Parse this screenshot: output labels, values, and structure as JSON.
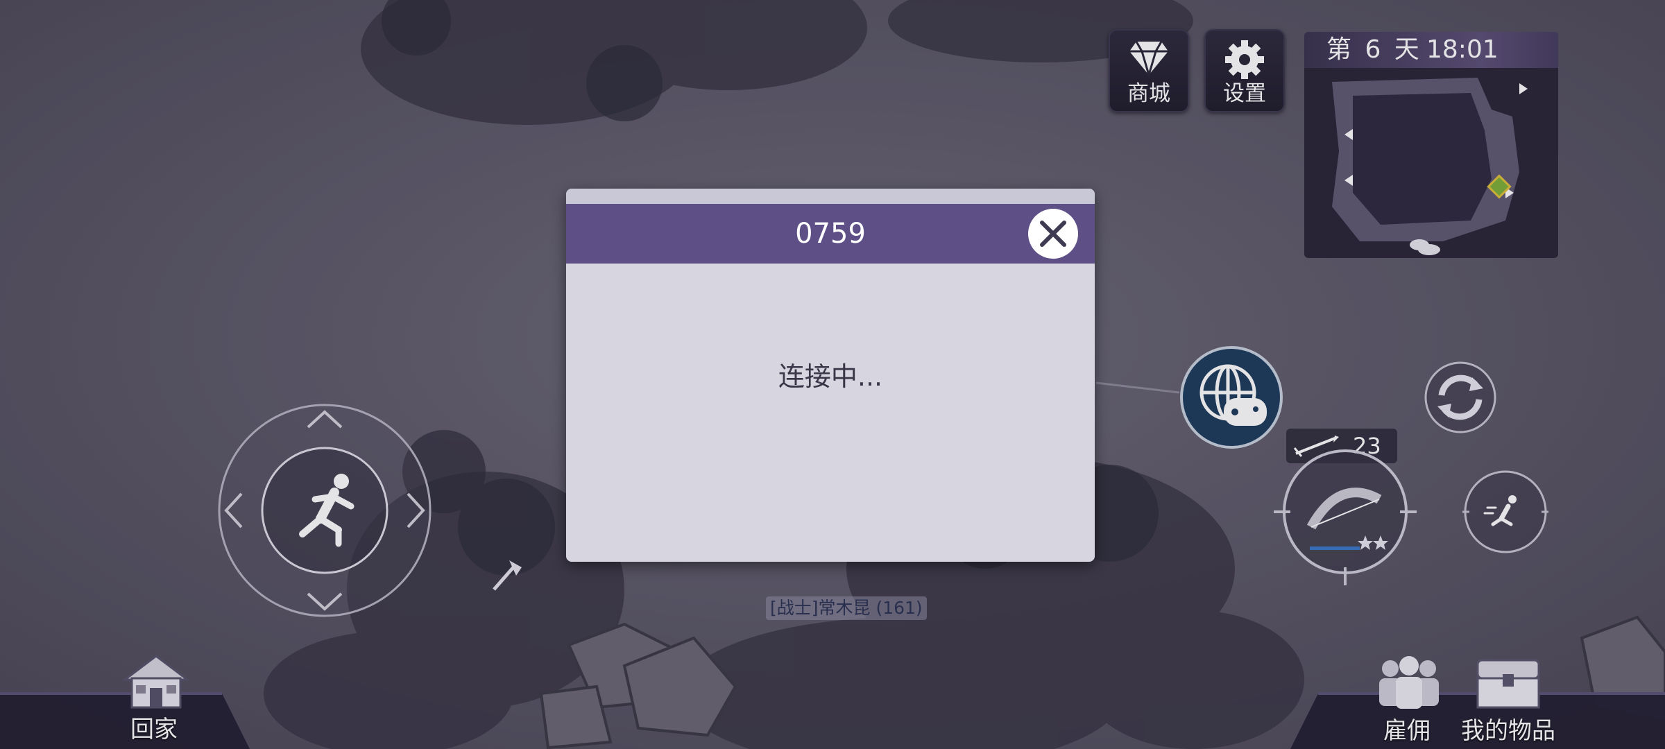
{
  "top_buttons": {
    "shop_label": "商城",
    "settings_label": "设置"
  },
  "minimap": {
    "day_label": "第 6 天",
    "time": "18:01"
  },
  "dialog": {
    "title": "0759",
    "message": "连接中..."
  },
  "weapon": {
    "arrow_count": "23",
    "stars": 2
  },
  "character": {
    "name_label": "[战士]常木昆 (161)"
  },
  "bottom_bar": {
    "home_label": "回家",
    "hire_label": "雇佣",
    "inventory_label": "我的物品"
  },
  "colors": {
    "dialog_header": "#5e5087",
    "dialog_body": "#d6d5e0",
    "online_button": "#1d3d5e"
  },
  "icons": {
    "shop": "diamond-icon",
    "settings": "gear-icon",
    "close": "close-icon",
    "joystick": "running-man-icon",
    "online": "globe-gamepad-icon",
    "refresh": "refresh-icon",
    "bow": "bow-icon",
    "sprint": "sprint-icon",
    "home": "house-icon",
    "hire": "group-people-icon",
    "inventory": "chest-icon"
  }
}
